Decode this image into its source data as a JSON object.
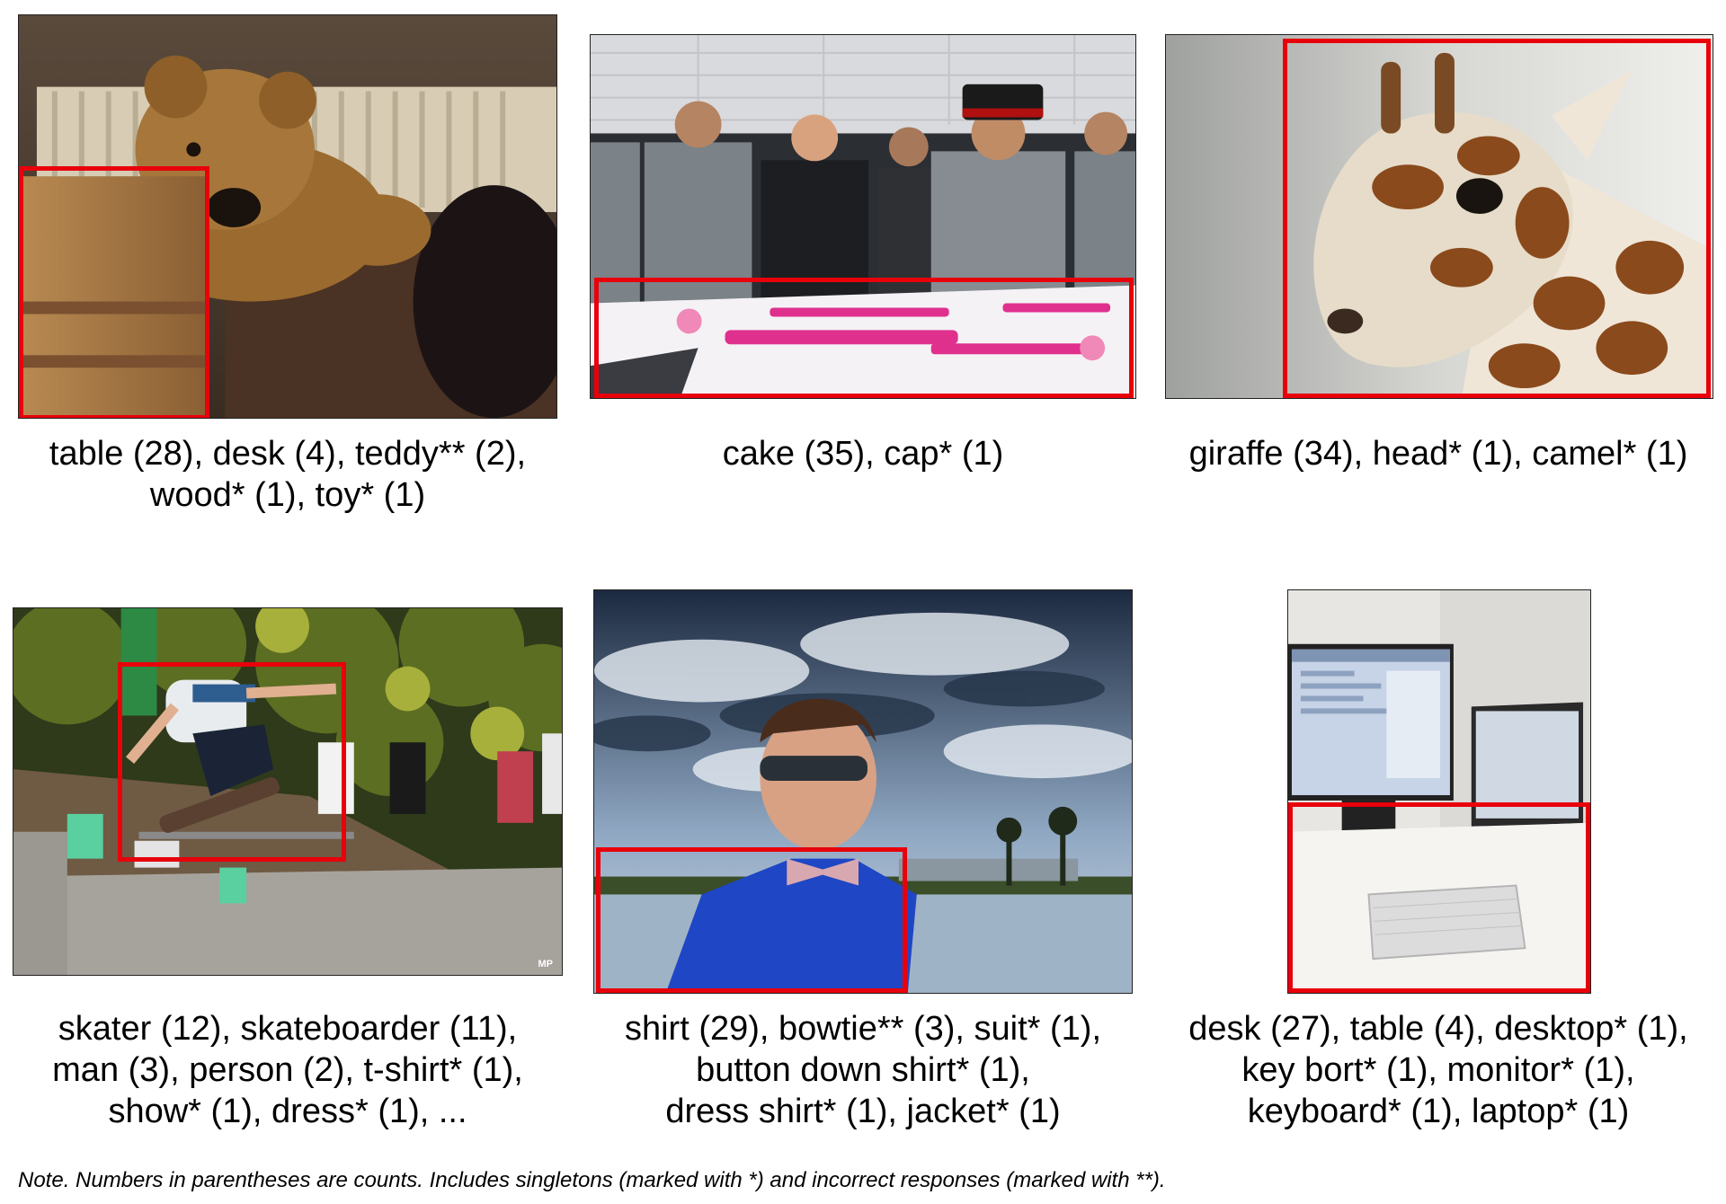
{
  "panels": [
    {
      "scene": "teddy bear leaning on wooden table",
      "caption_lines": [
        "table (28), desk (4), teddy** (2),",
        "wood* (1), toy* (1)"
      ]
    },
    {
      "scene": "officers cutting ceremony cake",
      "caption_lines": [
        "cake (35), cap* (1)"
      ]
    },
    {
      "scene": "giraffe head close-up",
      "caption_lines": [
        "giraffe (34), head* (1), camel* (1)"
      ]
    },
    {
      "scene": "skateboarder jumping over rail",
      "caption_lines": [
        "skater (12), skateboarder (11),",
        "man (3), person (2), t-shirt* (1),",
        "show* (1), dress* (1), ..."
      ]
    },
    {
      "scene": "man in sunglasses and bowtie under cloudy sky",
      "caption_lines": [
        "shirt (29), bowtie** (3), suit* (1),",
        "button down shirt* (1),",
        "dress shirt* (1), jacket* (1)"
      ]
    },
    {
      "scene": "desk with monitor, laptop and keyboard",
      "caption_lines": [
        "desk (27), table (4), desktop* (1),",
        "key bort* (1), monitor* (1),",
        "keyboard* (1), laptop* (1)"
      ]
    }
  ],
  "watermark": "MP",
  "note": "Note.  Numbers in parentheses are counts. Includes singletons (marked with *) and incorrect responses (marked with **).",
  "colors": {
    "bbox": "#e8000b"
  }
}
